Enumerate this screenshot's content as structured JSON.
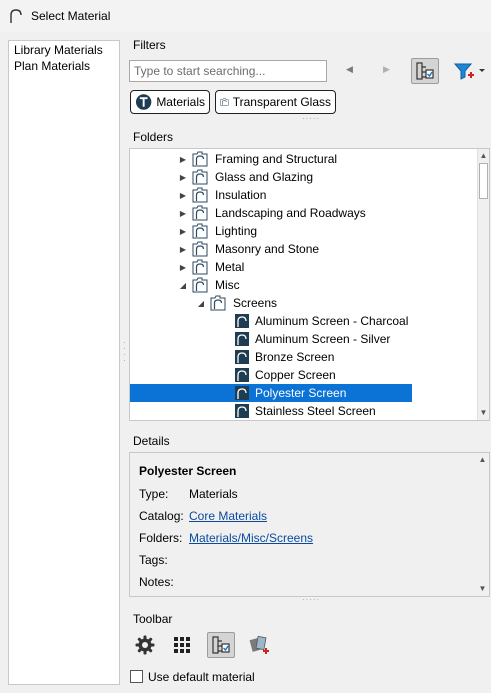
{
  "window": {
    "title": "Select Material"
  },
  "left_panel": {
    "items": [
      "Library Materials",
      "Plan Materials"
    ]
  },
  "filters": {
    "label": "Filters",
    "search_placeholder": "Type to start searching...",
    "chips": [
      "Materials",
      "Transparent Glass"
    ]
  },
  "folders": {
    "label": "Folders",
    "rows": [
      {
        "label": "Framing and Structural",
        "kind": "folder",
        "level": 2,
        "expanded": false
      },
      {
        "label": "Glass and Glazing",
        "kind": "folder",
        "level": 2,
        "expanded": false
      },
      {
        "label": "Insulation",
        "kind": "folder",
        "level": 2,
        "expanded": false
      },
      {
        "label": "Landscaping and Roadways",
        "kind": "folder",
        "level": 2,
        "expanded": false
      },
      {
        "label": "Lighting",
        "kind": "folder",
        "level": 2,
        "expanded": false
      },
      {
        "label": "Masonry and Stone",
        "kind": "folder",
        "level": 2,
        "expanded": false
      },
      {
        "label": "Metal",
        "kind": "folder",
        "level": 2,
        "expanded": false
      },
      {
        "label": "Misc",
        "kind": "folder",
        "level": 2,
        "expanded": true
      },
      {
        "label": "Screens",
        "kind": "folder",
        "level": 3,
        "expanded": true
      },
      {
        "label": "Aluminum Screen - Charcoal",
        "kind": "material",
        "level": 4
      },
      {
        "label": "Aluminum Screen - Silver",
        "kind": "material",
        "level": 4
      },
      {
        "label": "Bronze Screen",
        "kind": "material",
        "level": 4
      },
      {
        "label": "Copper Screen",
        "kind": "material",
        "level": 4
      },
      {
        "label": "Polyester Screen",
        "kind": "material",
        "level": 4,
        "selected": true
      },
      {
        "label": "Stainless Steel Screen",
        "kind": "material",
        "level": 4
      }
    ]
  },
  "details": {
    "label": "Details",
    "name": "Polyester Screen",
    "type_key": "Type:",
    "type_value": "Materials",
    "catalog_key": "Catalog:",
    "catalog_value": "Core Materials",
    "folders_key": "Folders:",
    "folders_value": "Materials/Misc/Screens",
    "tags_key": "Tags:",
    "notes_key": "Notes:"
  },
  "toolbar": {
    "label": "Toolbar"
  },
  "default_material": {
    "label": "Use default material",
    "checked": false
  },
  "colors": {
    "selection": "#0b72d6",
    "link": "#0a4a9e",
    "icon_dark": "#1e3d52"
  }
}
